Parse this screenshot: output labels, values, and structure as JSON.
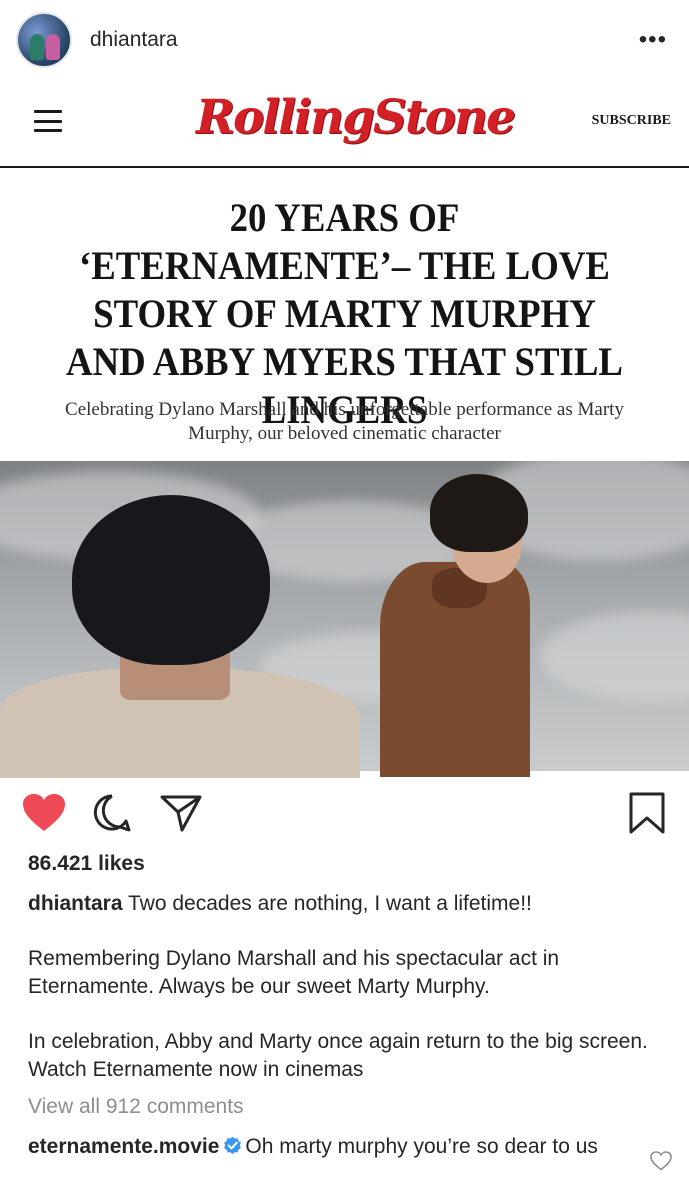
{
  "post": {
    "username": "dhiantara",
    "more_icon": "more-horizontal-icon"
  },
  "magazine": {
    "logo_text": "RollingStone",
    "subscribe_label": "SUBSCRIBE",
    "headline": "20 YEARS OF ‘ETERNAMENTE’– THE LOVE STORY OF MARTY MURPHY AND ABBY MYERS THAT STILL LINGERS",
    "subhead": "Celebrating Dylano Marshall and his unforgettable performance as Marty Murphy, our beloved cinematic character",
    "brand_color": "#d32027"
  },
  "actions": {
    "liked": true,
    "like_color": "#ed4956",
    "icons": [
      "heart-icon",
      "comment-icon",
      "share-icon",
      "bookmark-icon"
    ]
  },
  "likes_text": "86.421 likes",
  "caption": {
    "user": "dhiantara",
    "line1": "Two decades are nothing, I want a lifetime!!",
    "para2": "Remembering Dylano Marshall and his spectacular act in Eternamente. Always be our sweet Marty Murphy.",
    "para3": "In celebration, Abby and Marty once again return to the big screen. Watch Eternamente now in cinemas"
  },
  "view_comments": "View all 912 comments",
  "top_comment": {
    "user": "eternamente.movie",
    "verified": true,
    "text": "Oh marty murphy you’re so dear to us",
    "verified_color": "#3897f0"
  }
}
